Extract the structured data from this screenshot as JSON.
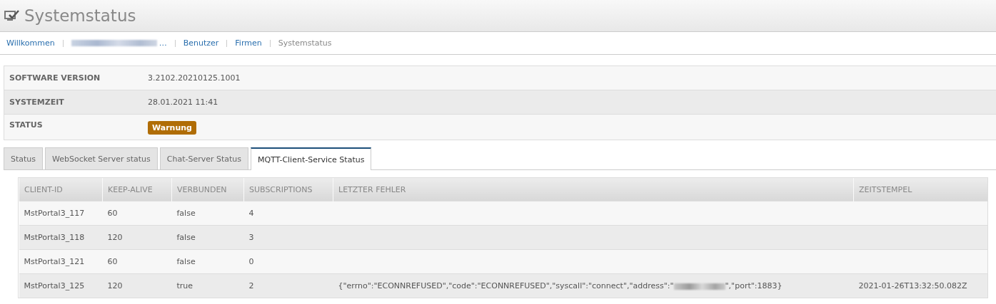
{
  "header": {
    "title": "Systemstatus"
  },
  "breadcrumb": [
    {
      "label": "Willkommen",
      "kind": "link"
    },
    {
      "label": "…",
      "kind": "redacted"
    },
    {
      "label": "Benutzer",
      "kind": "link"
    },
    {
      "label": "Firmen",
      "kind": "link"
    },
    {
      "label": "Systemstatus",
      "kind": "current"
    }
  ],
  "info": [
    {
      "label": "SOFTWARE VERSION",
      "value": "3.2102.20210125.1001",
      "kind": "text"
    },
    {
      "label": "SYSTEMZEIT",
      "value": "28.01.2021 11:41",
      "kind": "text"
    },
    {
      "label": "STATUS",
      "value": "Warnung",
      "kind": "badge",
      "color": "#b06d06"
    }
  ],
  "tabs": [
    {
      "label": "Status",
      "selected": false
    },
    {
      "label": "WebSocket Server status",
      "selected": false
    },
    {
      "label": "Chat-Server Status",
      "selected": false
    },
    {
      "label": "MQTT-Client-Service Status",
      "selected": true
    }
  ],
  "table": {
    "columns": [
      "CLIENT-ID",
      "KEEP-ALIVE",
      "VERBUNDEN",
      "SUBSCRIPTIONS",
      "LETZTER FEHLER",
      "ZEITSTEMPEL"
    ],
    "rows": [
      {
        "client_id": "MstPortal3_117",
        "keep_alive": "60",
        "connected": "false",
        "subscriptions": "4"
      },
      {
        "client_id": "MstPortal3_118",
        "keep_alive": "120",
        "connected": "false",
        "subscriptions": "3"
      },
      {
        "client_id": "MstPortal3_121",
        "keep_alive": "60",
        "connected": "false",
        "subscriptions": "0"
      },
      {
        "client_id": "MstPortal3_125",
        "keep_alive": "120",
        "connected": "true",
        "subscriptions": "2",
        "error_before": "{\"errno\":\"ECONNREFUSED\",\"code\":\"ECONNREFUSED\",\"syscall\":\"connect\",\"address\":\"",
        "error_after": "\",\"port\":1883}",
        "timestamp": "2021-01-26T13:32:50.082Z"
      }
    ]
  }
}
